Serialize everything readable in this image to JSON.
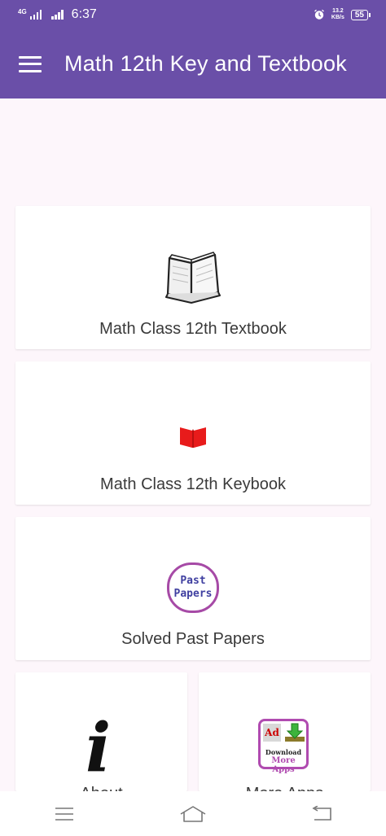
{
  "status_bar": {
    "network": "4G",
    "time": "6:37",
    "speed_value": "13.2",
    "speed_unit": "KB/s",
    "battery": "55"
  },
  "app_bar": {
    "title": "Math 12th Key and Textbook",
    "color": "#6a4fa8"
  },
  "cards": {
    "textbook": {
      "label": "Math Class 12th Textbook",
      "icon": "open-book-icon"
    },
    "keybook": {
      "label": "Math Class 12th Keybook",
      "icon": "red-book-icon"
    },
    "past_papers": {
      "label": "Solved Past Papers",
      "icon": "past-papers-icon",
      "icon_line1": "Past",
      "icon_line2": "Papers"
    },
    "about": {
      "label": "About",
      "icon": "info-icon",
      "glyph": "i"
    },
    "more_apps": {
      "label": "More Apps",
      "icon": "more-apps-icon",
      "ad": "Ad",
      "download": "Download",
      "more_apps_text": "More Apps"
    }
  },
  "nav": {
    "items": [
      "menu-nav",
      "home-nav",
      "back-nav"
    ]
  }
}
